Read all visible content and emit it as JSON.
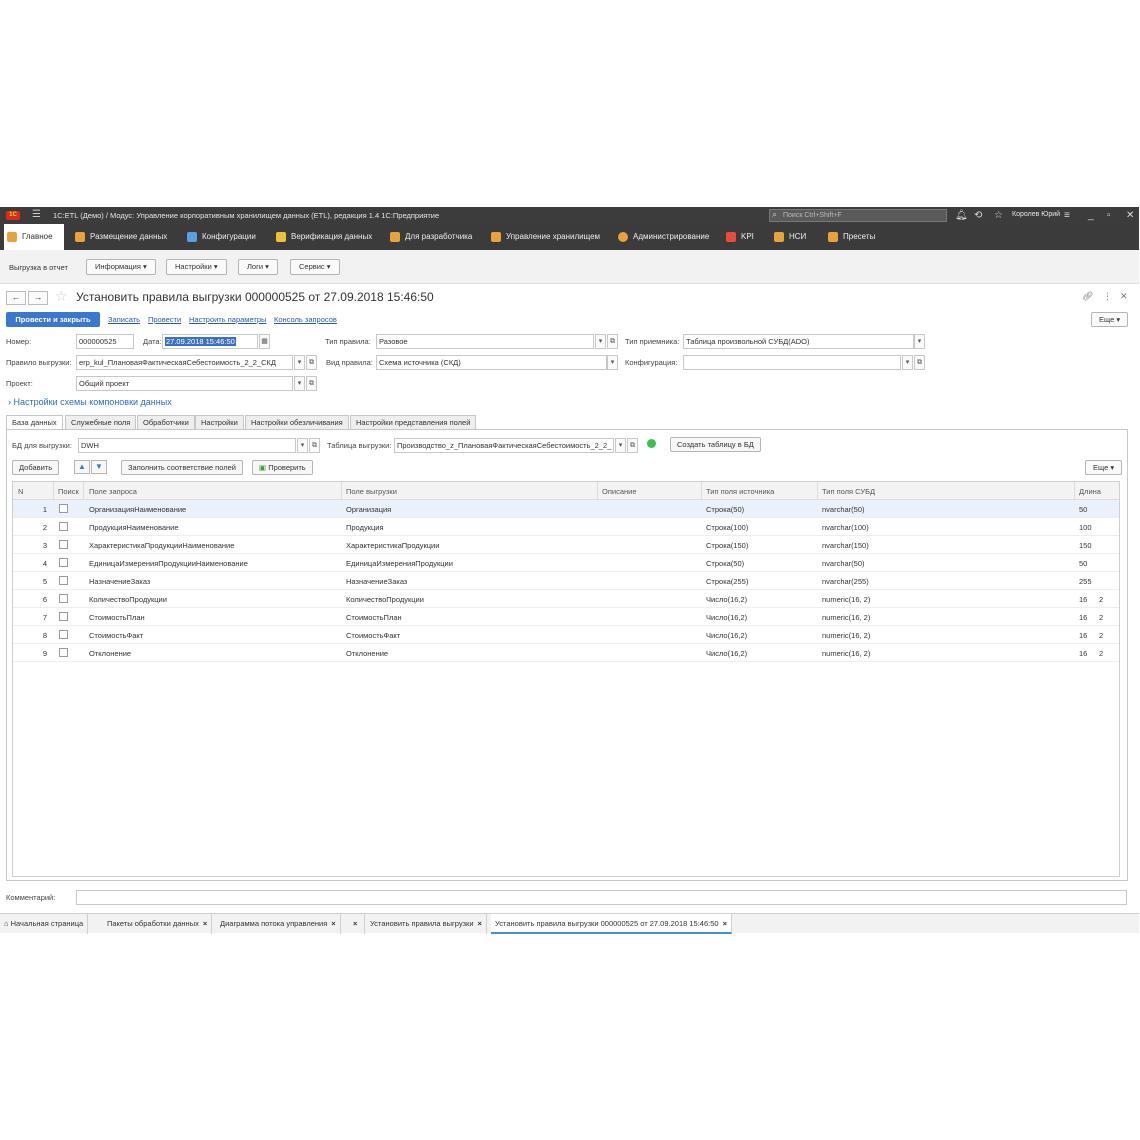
{
  "titlebar": {
    "logo": "1C",
    "title": "1С:ETL (Демо) / Модус: Управление корпоративным хранилищем данных (ETL), редакция 1.4  1С:Предприятие",
    "search_placeholder": "Поиск Ctrl+Shift+F",
    "user": "Королев Юрий"
  },
  "sections": [
    {
      "label": "Главное",
      "color": "#e8a23c"
    },
    {
      "label": "Размещение данных",
      "color": "#e8a23c"
    },
    {
      "label": "Конфигурации",
      "color": "#5aa0e0"
    },
    {
      "label": "Верификация данных",
      "color": "#e8c23c"
    },
    {
      "label": "Для разработчика",
      "color": "#e8a23c"
    },
    {
      "label": "Управление хранилищем",
      "color": "#e8a23c"
    },
    {
      "label": "Администрирование",
      "color": "#e8a23c"
    },
    {
      "label": "KPI",
      "color": "#e84c3c"
    },
    {
      "label": "НСИ",
      "color": "#e8a23c"
    },
    {
      "label": "Пресеты",
      "color": "#e8a23c"
    }
  ],
  "subbar": {
    "label": "Выгрузка в отчет",
    "info": "Информация",
    "settings": "Настройки",
    "logs": "Логи",
    "service": "Сервис"
  },
  "form": {
    "title": "Установить правила выгрузки 000000525 от 27.09.2018 15:46:50",
    "post_close": "Провести и закрыть",
    "write": "Записать",
    "post": "Провести",
    "configure": "Настроить параметры",
    "console": "Консоль запросов",
    "more": "Еще"
  },
  "fields": {
    "number_label": "Номер:",
    "number": "000000525",
    "date_label": "Дата:",
    "date": "27.09.2018 15:46:50",
    "rule_type_label": "Тип правила:",
    "rule_type": "Разовое",
    "receiver_type_label": "Тип приемника:",
    "receiver_type": "Таблица произвольной СУБД(ADO)",
    "unload_rule_label": "Правило выгрузки:",
    "unload_rule": "erp_kul_ПлановаяФактическаяСебестоимость_2_2_СКД",
    "rule_kind_label": "Вид правила:",
    "rule_kind": "Схема источника (СКД)",
    "configuration_label": "Конфигурация:",
    "configuration": "",
    "project_label": "Проект:",
    "project": "Общий проект"
  },
  "expander": "Настройки схемы компоновки данных",
  "tabs": [
    "База данных",
    "Служебные поля",
    "Обработчики",
    "Настройки",
    "Настройки обезличивания",
    "Настройки представления полей"
  ],
  "db": {
    "db_label": "БД для выгрузки:",
    "db": "DWH",
    "table_label": "Таблица выгрузки:",
    "table": "Производство_z_ПлановаяФактическаяСебестоимость_2_2_",
    "create_table": "Создать таблицу в БД"
  },
  "gridbar": {
    "add": "Добавить",
    "fill": "Заполнить соответствие полей",
    "check": "Проверить",
    "more": "Еще"
  },
  "grid": {
    "headers": [
      "N",
      "Поиск",
      "Поле запроса",
      "Поле выгрузки",
      "Описание",
      "Тип поля источника",
      "Тип поля СУБД",
      "Длина"
    ],
    "rows": [
      {
        "n": "1",
        "query": "ОрганизацияНаименование",
        "out": "Организация",
        "desc": "",
        "src": "Строка(50)",
        "dbt": "nvarchar(50)",
        "len": "50",
        "prec": ""
      },
      {
        "n": "2",
        "query": "ПродукцияНаименование",
        "out": "Продукция",
        "desc": "",
        "src": "Строка(100)",
        "dbt": "nvarchar(100)",
        "len": "100",
        "prec": ""
      },
      {
        "n": "3",
        "query": "ХарактеристикаПродукцииНаименование",
        "out": "ХарактеристикаПродукции",
        "desc": "",
        "src": "Строка(150)",
        "dbt": "nvarchar(150)",
        "len": "150",
        "prec": ""
      },
      {
        "n": "4",
        "query": "ЕдиницаИзмеренияПродукцииНаименование",
        "out": "ЕдиницаИзмеренияПродукции",
        "desc": "",
        "src": "Строка(50)",
        "dbt": "nvarchar(50)",
        "len": "50",
        "prec": ""
      },
      {
        "n": "5",
        "query": "НазначениеЗаказ",
        "out": "НазначениеЗаказ",
        "desc": "",
        "src": "Строка(255)",
        "dbt": "nvarchar(255)",
        "len": "255",
        "prec": ""
      },
      {
        "n": "6",
        "query": "КоличествоПродукции",
        "out": "КоличествоПродукции",
        "desc": "",
        "src": "Число(16,2)",
        "dbt": "numeric(16, 2)",
        "len": "16",
        "prec": "2"
      },
      {
        "n": "7",
        "query": "СтоимостьПлан",
        "out": "СтоимостьПлан",
        "desc": "",
        "src": "Число(16,2)",
        "dbt": "numeric(16, 2)",
        "len": "16",
        "prec": "2"
      },
      {
        "n": "8",
        "query": "СтоимостьФакт",
        "out": "СтоимостьФакт",
        "desc": "",
        "src": "Число(16,2)",
        "dbt": "numeric(16, 2)",
        "len": "16",
        "prec": "2"
      },
      {
        "n": "9",
        "query": "Отклонение",
        "out": "Отклонение",
        "desc": "",
        "src": "Число(16,2)",
        "dbt": "numeric(16, 2)",
        "len": "16",
        "prec": "2"
      }
    ]
  },
  "comment": {
    "label": "Комментарий:",
    "value": ""
  },
  "bottom_tabs": [
    {
      "label": "Начальная страница",
      "closable": false
    },
    {
      "label": "Пакеты обработки данных",
      "closable": true
    },
    {
      "label": "Диаграмма потока управления",
      "closable": true
    },
    {
      "label": "",
      "closable": true
    },
    {
      "label": "Установить правила выгрузки",
      "closable": true
    },
    {
      "label": "Установить правила выгрузки 000000525 от 27.09.2018 15:46:50",
      "closable": true
    }
  ]
}
